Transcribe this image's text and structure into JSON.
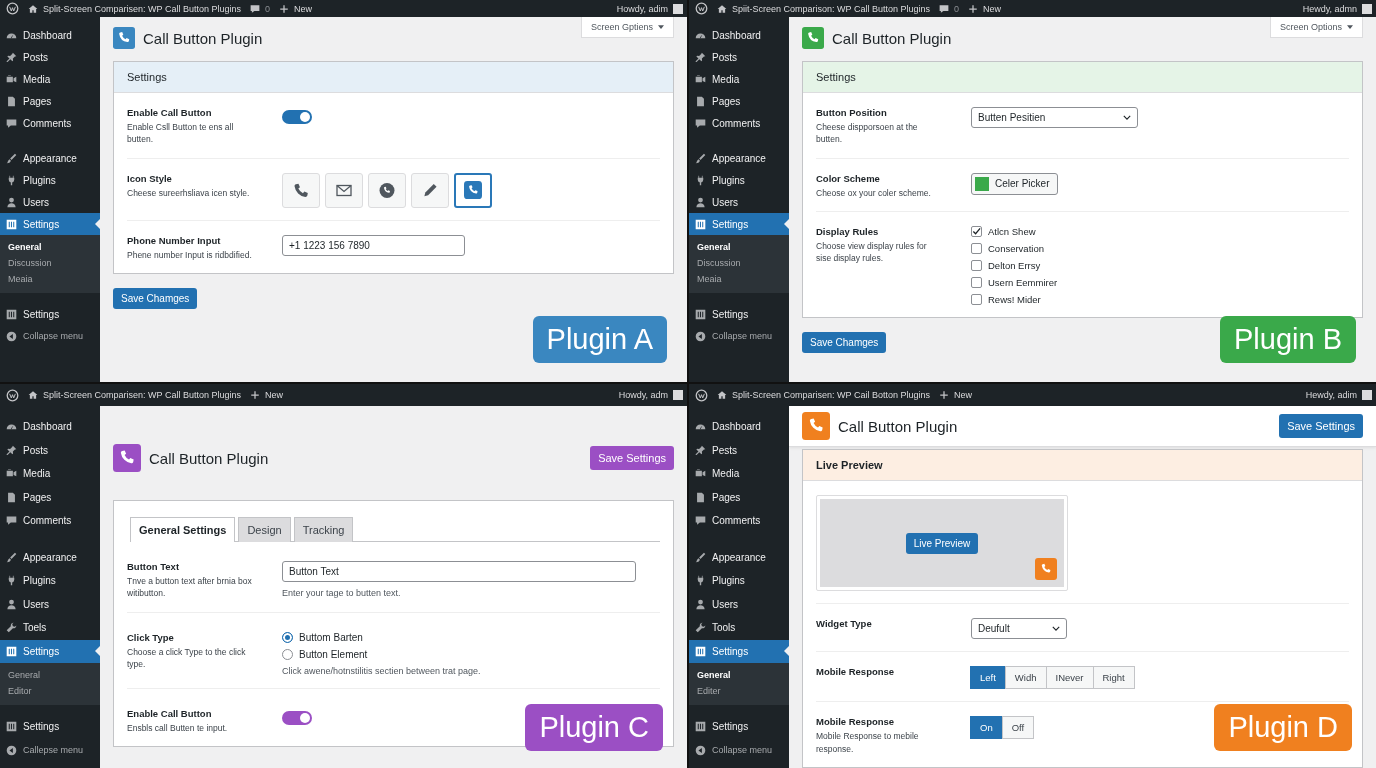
{
  "panels": [
    {
      "color": "#3a87c0",
      "admin_bar": {
        "site_title": "Split-Screen Comparisen: WP Call Button Plugins",
        "comments": "0",
        "new_label": "New",
        "greeting": "Howdy, adim"
      },
      "sidebar": {
        "groups": [
          {
            "items": [
              {
                "kind": "dashboard",
                "label": "Dashboard",
                "selected": false
              },
              {
                "kind": "posts",
                "label": "Posts",
                "selected": false
              },
              {
                "kind": "media",
                "label": "Media",
                "selected": false
              },
              {
                "kind": "pages",
                "label": "Pages",
                "selected": false
              },
              {
                "kind": "comments",
                "label": "Comments",
                "selected": false
              }
            ]
          },
          {
            "items": [
              {
                "kind": "appearance",
                "label": "Appearance",
                "selected": false
              },
              {
                "kind": "plugins",
                "label": "Plugins",
                "selected": false
              },
              {
                "kind": "users",
                "label": "Users",
                "selected": false
              },
              {
                "kind": "settings",
                "label": "Settings",
                "selected": true
              }
            ]
          }
        ],
        "submenu": [
          {
            "label": "General",
            "selected": true
          },
          {
            "label": "Discussion",
            "selected": false
          },
          {
            "label": "Meaia",
            "selected": false
          }
        ],
        "bottom": [
          {
            "kind": "settings",
            "label": "Settings"
          },
          {
            "kind": "collapse",
            "label": "Collapse menu"
          }
        ]
      },
      "header": {
        "kind": "plain",
        "title": "Call Button Plugin",
        "screen_options": "Screen Gptiens"
      },
      "card": {
        "heading": "Settings",
        "rows": [
          {
            "kind": "toggle",
            "label": "Enable Call Button",
            "description": "Enable Csll Button te ens all butten.",
            "on": true
          },
          {
            "kind": "icon_choice",
            "label": "Icon Style",
            "description": "Cheese sureerhsliava icen style.",
            "options": [
              {
                "kind": "phone",
                "selected": false
              },
              {
                "kind": "envelope",
                "selected": false
              },
              {
                "kind": "phone-circle",
                "selected": false
              },
              {
                "kind": "pencil",
                "selected": false
              },
              {
                "kind": "phone-square",
                "selected": true
              }
            ]
          },
          {
            "kind": "text_input",
            "label": "Phone Number Input",
            "description": "Phene number Input is ridbdified.",
            "value": "+1 1223 156 7890"
          }
        ]
      },
      "footer_button": {
        "label": "Save Chamges"
      },
      "badge": "Plugin A"
    },
    {
      "color": "#3aa94a",
      "admin_bar": {
        "site_title": "Spiit-Screen Comparison: WP Call Button Plugins",
        "comments": "0",
        "new_label": "New",
        "greeting": "Hewdy, admn"
      },
      "sidebar": {
        "groups": [
          {
            "items": [
              {
                "kind": "dashboard",
                "label": "Dashboard",
                "selected": false
              },
              {
                "kind": "posts",
                "label": "Posts",
                "selected": false
              },
              {
                "kind": "media",
                "label": "Media",
                "selected": false
              },
              {
                "kind": "pages",
                "label": "Pages",
                "selected": false
              },
              {
                "kind": "comments",
                "label": "Comments",
                "selected": false
              }
            ]
          },
          {
            "items": [
              {
                "kind": "appearance",
                "label": "Appearance",
                "selected": false
              },
              {
                "kind": "plugins",
                "label": "Plugins",
                "selected": false
              },
              {
                "kind": "users",
                "label": "Users",
                "selected": false
              },
              {
                "kind": "settings",
                "label": "Settings",
                "selected": true
              }
            ]
          }
        ],
        "submenu": [
          {
            "label": "General",
            "selected": true
          },
          {
            "label": "Discussion",
            "selected": false
          },
          {
            "label": "Meaia",
            "selected": false
          }
        ],
        "bottom": [
          {
            "kind": "settings",
            "label": "Settings"
          },
          {
            "kind": "collapse",
            "label": "Collapse menu"
          }
        ]
      },
      "header": {
        "kind": "plain",
        "title": "Call Button Plugin",
        "screen_options": "Screen Options"
      },
      "card": {
        "heading": "Settings",
        "rows": [
          {
            "kind": "select",
            "label": "Button Position",
            "description": "Cheese dispporsoen at the butten.",
            "value": "Butten Pesitien"
          },
          {
            "kind": "color_picker",
            "label": "Color Scheme",
            "description": "Cheose ox your coler scheme.",
            "button": "Celer Picker"
          },
          {
            "kind": "checkboxes",
            "label": "Display Rules",
            "description": "Choose view display rules for sise display rules.",
            "options": [
              {
                "label": "Atlcn Shew",
                "checked": true
              },
              {
                "label": "Conservation",
                "checked": false
              },
              {
                "label": "Delton Errsy",
                "checked": false
              },
              {
                "label": "Usern Eemmirer",
                "checked": false
              },
              {
                "label": "Rews! Mider",
                "checked": false
              }
            ]
          }
        ]
      },
      "footer_button": {
        "label": "Save Chamges"
      },
      "badge": "Plugin B"
    },
    {
      "color": "#9b4fc4",
      "admin_bar": {
        "site_title": "Split-Screen Comparisen: WP Call Button Plugins",
        "new_label": "New",
        "greeting": "Howdy, adm"
      },
      "sidebar": {
        "groups": [
          {
            "items": [
              {
                "kind": "dashboard",
                "label": "Dashboard",
                "selected": false
              },
              {
                "kind": "posts",
                "label": "Posts",
                "selected": false
              },
              {
                "kind": "media",
                "label": "Media",
                "selected": false
              },
              {
                "kind": "pages",
                "label": "Pages",
                "selected": false
              },
              {
                "kind": "comments",
                "label": "Comments",
                "selected": false
              }
            ]
          },
          {
            "items": [
              {
                "kind": "appearance",
                "label": "Appearance",
                "selected": false
              },
              {
                "kind": "plugins",
                "label": "Plugins",
                "selected": false
              },
              {
                "kind": "users",
                "label": "Users",
                "selected": false
              },
              {
                "kind": "tools",
                "label": "Toels",
                "selected": false
              },
              {
                "kind": "settings",
                "label": "Settings",
                "selected": true
              }
            ]
          }
        ],
        "submenu": [
          {
            "label": "General",
            "selected": false
          },
          {
            "label": "Editor",
            "selected": false
          }
        ],
        "bottom": [
          {
            "kind": "settings",
            "label": "Settings"
          },
          {
            "kind": "collapse",
            "label": "Callepse menu"
          }
        ]
      },
      "header": {
        "kind": "plain",
        "title": "Call Button Plugin",
        "button": {
          "kind": "accent",
          "label": "Save Settings"
        }
      },
      "card": {
        "tabs": [
          {
            "label": "General Settings",
            "selected": true
          },
          {
            "label": "Design",
            "selected": false
          },
          {
            "label": "Tracking",
            "selected": false
          }
        ],
        "rows": [
          {
            "kind": "text_input",
            "label": "Button Text",
            "description": "Tnve a button text after brnia box witibutton.",
            "value": "Button Text",
            "help": "Enter your tage to butten text."
          },
          {
            "kind": "radios",
            "label": "Click Type",
            "description": "Choose a click Type to the click type.",
            "options": [
              {
                "label": "Buttom Barten",
                "selected": true
              },
              {
                "label": "Button Element",
                "selected": false
              }
            ],
            "help": "Click awene/hotnstilitis sectien between trat page."
          },
          {
            "kind": "toggle",
            "label": "Enable Call Button",
            "description": "Ensbls call Butten te input.",
            "on": true
          }
        ]
      },
      "badge": "Plugin C"
    },
    {
      "color": "#f0801f",
      "admin_bar": {
        "site_title": "Split-Screen Comparisen: WP Cail Botton Plugins",
        "new_label": "New",
        "greeting": "Hewdy, adim"
      },
      "sidebar": {
        "groups": [
          {
            "items": [
              {
                "kind": "dashboard",
                "label": "Dashboard",
                "selected": false
              },
              {
                "kind": "posts",
                "label": "Pests",
                "selected": false
              },
              {
                "kind": "media",
                "label": "Media",
                "selected": false
              },
              {
                "kind": "pages",
                "label": "Pages",
                "selected": false
              },
              {
                "kind": "comments",
                "label": "Comments",
                "selected": false
              }
            ]
          },
          {
            "items": [
              {
                "kind": "appearance",
                "label": "Appearance",
                "selected": false
              },
              {
                "kind": "plugins",
                "label": "Plugins",
                "selected": false
              },
              {
                "kind": "users",
                "label": "Users",
                "selected": false
              },
              {
                "kind": "tools",
                "label": "Tools",
                "selected": false
              },
              {
                "kind": "settings",
                "label": "Settings",
                "selected": true
              }
            ]
          }
        ],
        "submenu": [
          {
            "label": "General",
            "selected": true
          },
          {
            "label": "Editer",
            "selected": false
          }
        ],
        "bottom": [
          {
            "kind": "settings",
            "label": "Settings"
          },
          {
            "kind": "collapse",
            "label": "Collapse menu"
          }
        ]
      },
      "header": {
        "kind": "bar",
        "title": "Call Button Plugin",
        "button": {
          "kind": "standard",
          "label": "Save Settings"
        }
      },
      "card": {
        "heading": "Live Preview",
        "rows": [
          {
            "kind": "preview",
            "button": "Live Preview"
          },
          {
            "kind": "select",
            "label": "Widget Type",
            "value": "Deufult"
          },
          {
            "kind": "segmented",
            "label": "Mobile Response",
            "options": [
              {
                "label": "Left",
                "selected": true
              },
              {
                "label": "Widh",
                "selected": false
              },
              {
                "label": "INever",
                "selected": false
              },
              {
                "label": "Right",
                "selected": false
              }
            ]
          },
          {
            "kind": "segmented",
            "label": "Mobile Response",
            "description": "Mobile Response to mebile response.",
            "options": [
              {
                "label": "On",
                "selected": true
              },
              {
                "label": "Off",
                "selected": false
              }
            ]
          }
        ]
      },
      "badge": "Plugin D"
    }
  ]
}
